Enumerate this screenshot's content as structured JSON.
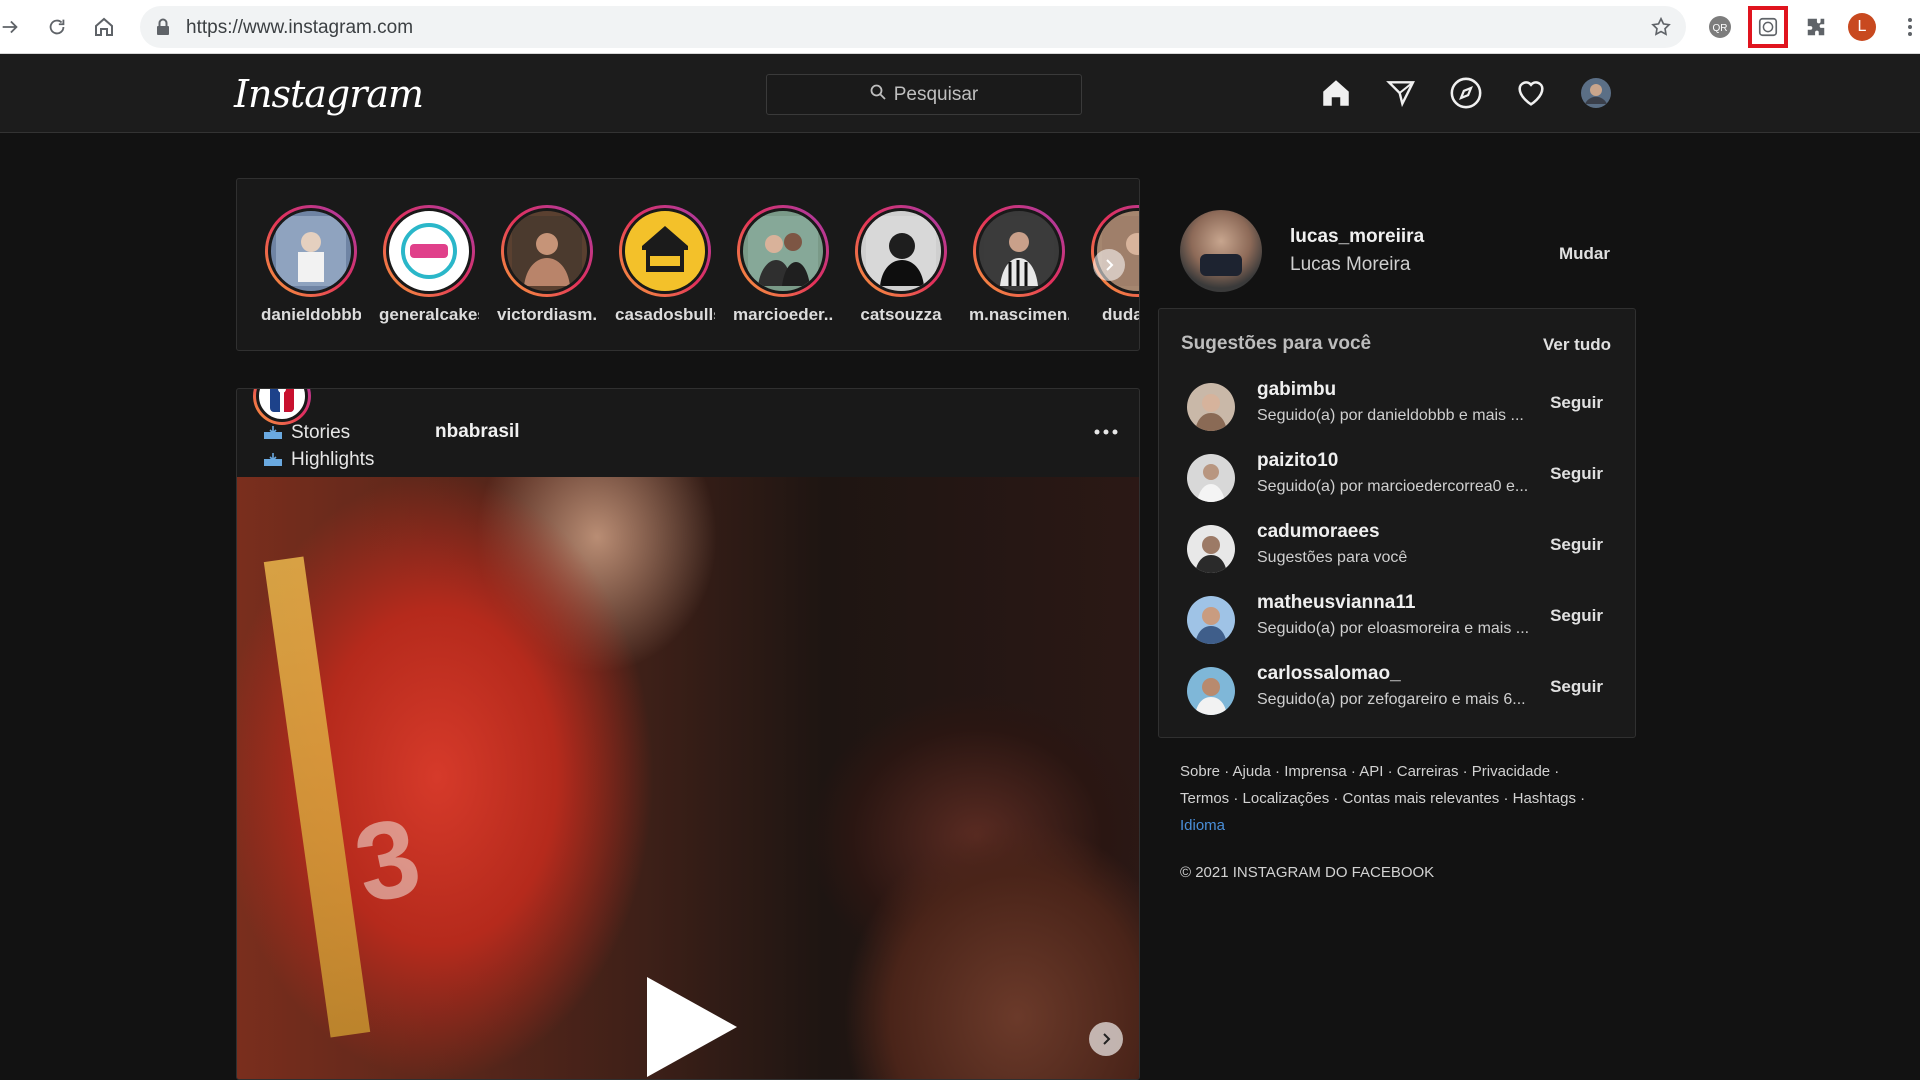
{
  "browser": {
    "url": "https://www.instagram.com",
    "profile_initial": "L"
  },
  "instagram": {
    "logo": "Instagram",
    "search_placeholder": "Pesquisar"
  },
  "stories": [
    {
      "username": "danieldobbb"
    },
    {
      "username": "generalcakes"
    },
    {
      "username": "victordiasm..."
    },
    {
      "username": "casadosbulls"
    },
    {
      "username": "marcioeder..."
    },
    {
      "username": "catsouzza"
    },
    {
      "username": "m.nascimen..."
    },
    {
      "username": "dudam..."
    }
  ],
  "post": {
    "username": "nbabrasil",
    "menu_links": [
      "Stories",
      "Highlights"
    ]
  },
  "profile": {
    "username": "lucas_moreiira",
    "full_name": "Lucas Moreira",
    "switch_label": "Mudar"
  },
  "suggestions": {
    "title": "Sugestões para você",
    "see_all": "Ver tudo",
    "follow_label": "Seguir",
    "items": [
      {
        "username": "gabimbu",
        "detail": "Seguido(a) por danieldobbb e mais ..."
      },
      {
        "username": "paizito10",
        "detail": "Seguido(a) por marcioedercorrea0 e..."
      },
      {
        "username": "cadumoraees",
        "detail": "Sugestões para você"
      },
      {
        "username": "matheusvianna11",
        "detail": "Seguido(a) por eloasmoreira e mais ..."
      },
      {
        "username": "carlossalomao_",
        "detail": "Seguido(a) por zefogareiro e mais 6..."
      }
    ]
  },
  "footer": {
    "line1": "Sobre · Ajuda · Imprensa · API · Carreiras · Privacidade ·",
    "line2": "Termos · Localizações · Contas mais relevantes · Hashtags ·",
    "language": "Idioma",
    "copyright": "© 2021 INSTAGRAM DO FACEBOOK"
  },
  "colors": {
    "page_bg": "#121212",
    "story_ring": "#e3305a",
    "extension_highlight": "#e0141e",
    "link_blue": "#4a8fd9"
  }
}
